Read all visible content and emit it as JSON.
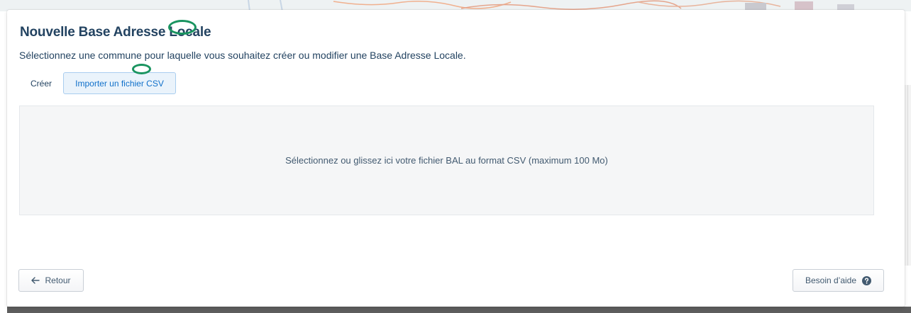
{
  "dialog": {
    "title": "Nouvelle Base Adresse Locale",
    "subtitle": "Sélectionnez une commune pour laquelle vous souhaitez créer ou modifier une Base Adresse Locale."
  },
  "tabs": [
    {
      "label": "Créer",
      "active": false
    },
    {
      "label": "Importer un fichier CSV",
      "active": true
    }
  ],
  "dropzone": {
    "text": "Sélectionnez ou glissez ici votre fichier BAL au format CSV (maximum 100 Mo)"
  },
  "footer": {
    "back_label": "Retour",
    "back_icon": "arrow-left-icon",
    "help_label": "Besoin d’aide",
    "help_icon": "question-circle-icon"
  },
  "colors": {
    "title": "#234361",
    "accent": "#1070ca",
    "annotation": "#1a9460"
  }
}
